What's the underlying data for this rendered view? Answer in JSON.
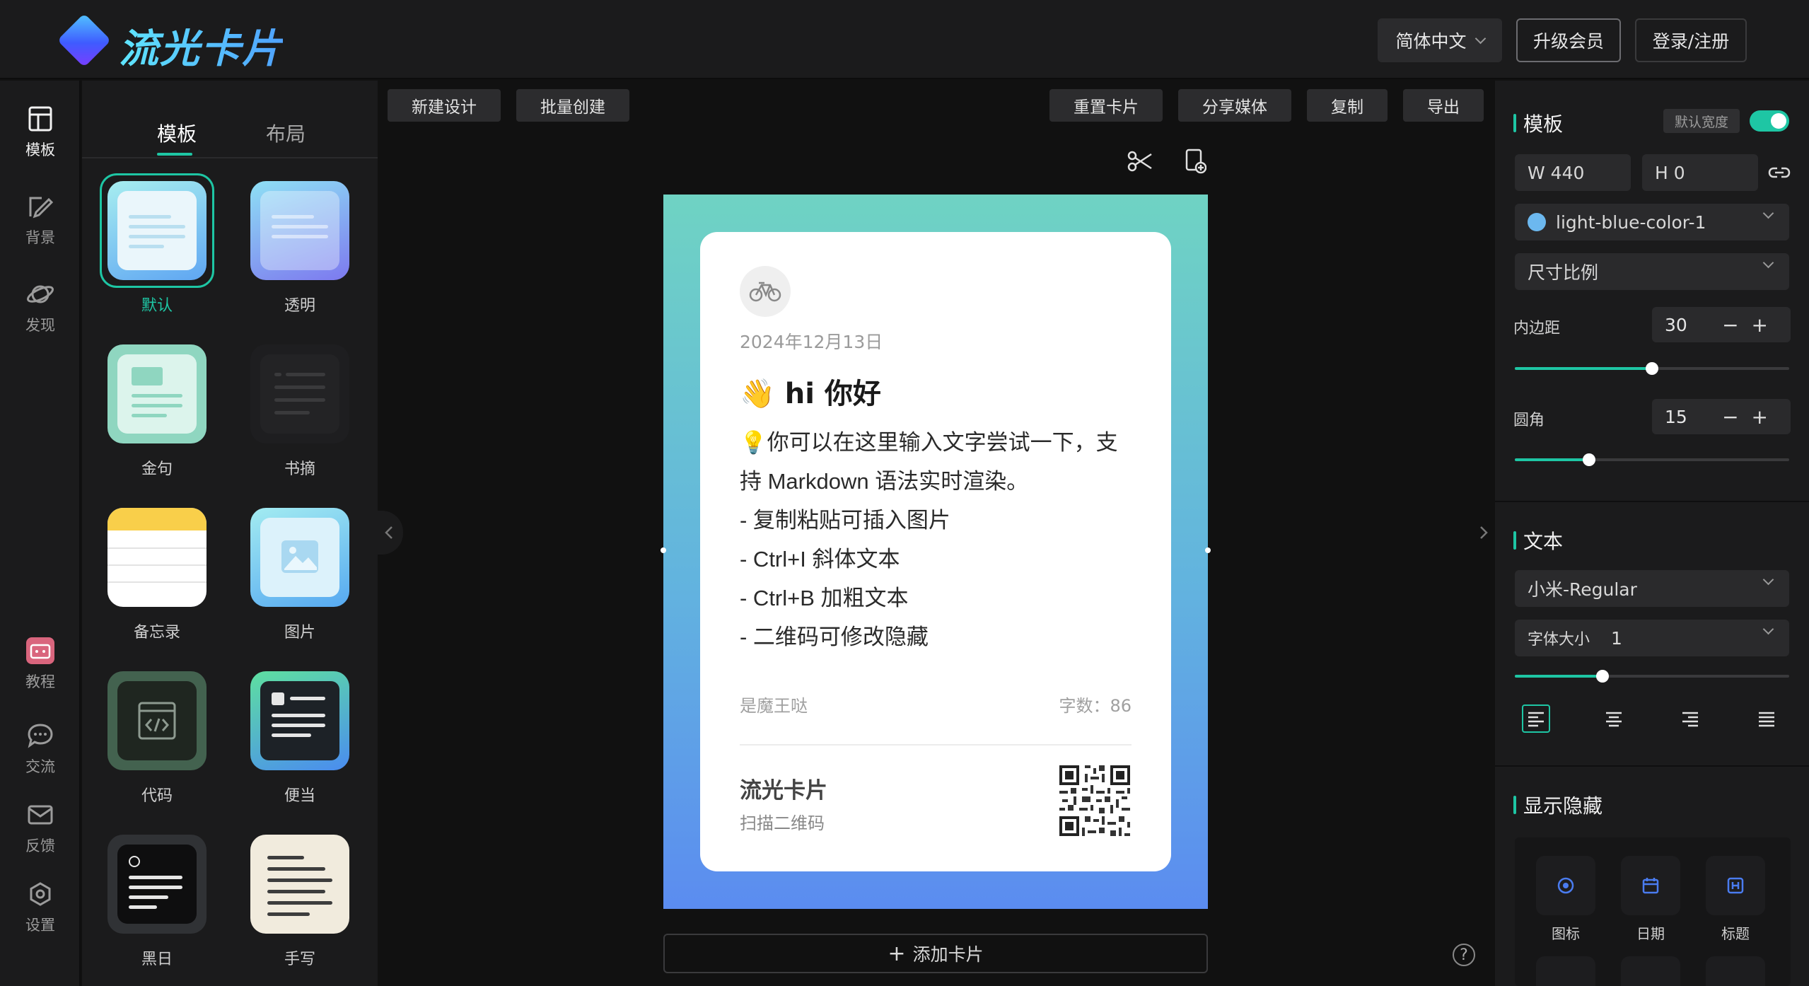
{
  "app": {
    "logo_text": "流光卡片",
    "header": {
      "language": "简体中文",
      "upgrade": "升级会员",
      "login": "登录/注册"
    }
  },
  "rail": {
    "items": [
      {
        "label": "模板",
        "icon": "template-icon"
      },
      {
        "label": "背景",
        "icon": "brush-icon"
      },
      {
        "label": "发现",
        "icon": "planet-icon"
      },
      {
        "label": "教程",
        "icon": "bilibili-icon"
      },
      {
        "label": "交流",
        "icon": "chat-icon"
      },
      {
        "label": "反馈",
        "icon": "mail-icon"
      },
      {
        "label": "设置",
        "icon": "settings-icon"
      }
    ]
  },
  "template_panel": {
    "tabs": [
      "模板",
      "布局"
    ],
    "active_tab": "模板",
    "templates": [
      "默认",
      "透明",
      "金句",
      "书摘",
      "备忘录",
      "图片",
      "代码",
      "便当",
      "黑日",
      "手写"
    ],
    "selected": "默认"
  },
  "toolbar": {
    "new_design": "新建设计",
    "batch_create": "批量创建",
    "reset_card": "重置卡片",
    "share_media": "分享媒体",
    "copy": "复制",
    "export": "导出"
  },
  "card": {
    "date": "2024年12月13日",
    "title_emoji": "👋",
    "title": "hi 你好",
    "body": [
      "💡你可以在这里输入文字尝试一下，支",
      "持 Markdown 语法实时渲染。",
      "- 复制粘贴可插入图片",
      "- Ctrl+I 斜体文本",
      "- Ctrl+B 加粗文本",
      "- 二维码可修改隐藏"
    ],
    "author": "是魔王哒",
    "word_count": "字数：86",
    "brand": "流光卡片",
    "brand_sub": "扫描二维码",
    "add_card": "添加卡片"
  },
  "right_panel": {
    "template_section": {
      "title": "模板",
      "default_width": "默认宽度",
      "default_width_on": true,
      "width": "W 440",
      "height": "H 0",
      "color": "light-blue-color-1",
      "ratio": "尺寸比例",
      "padding_label": "内边距",
      "padding": "30",
      "padding_level": 0.5,
      "radius_label": "圆角",
      "radius": "15",
      "radius_level": 0.27
    },
    "text_section": {
      "title": "文本",
      "font": "小米-Regular",
      "font_size_label": "字体大小",
      "font_size": "1",
      "font_size_level": 0.32,
      "alignment": "left"
    },
    "visibility_section": {
      "title": "显示隐藏",
      "items": [
        "图标",
        "日期",
        "标题"
      ]
    }
  },
  "help_glyph": "?",
  "colors": {
    "accent": "#1ec6a4",
    "gradient_top": "#6fd3c3",
    "gradient_bottom": "#5b8cf0"
  }
}
